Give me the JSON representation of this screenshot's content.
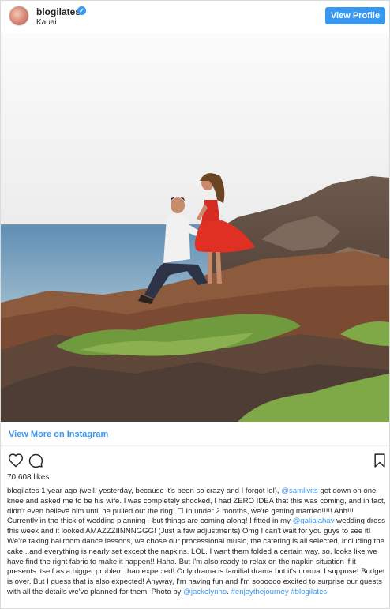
{
  "header": {
    "username": "blogilates",
    "location": "Kauai",
    "view_profile_label": "View Profile"
  },
  "photo": {
    "alt": "proposal photo"
  },
  "footer": {
    "view_more_label": "View More on Instagram",
    "likes": "70,608 likes"
  },
  "caption": {
    "username": "blogilates",
    "part1": " 1 year ago (well, yesterday, because it's been so crazy and I forgot lol), ",
    "mention1": "@samlivits",
    "part2": " got down on one knee and asked me to be his wife. I was completely shocked, I had ZERO IDEA that this was coming, and in fact, didn't even believe him until he pulled out the ring. ☐ In under 2 months, we're getting married!!!!! Ahh!!! Currently in the thick of wedding planning - but things are coming along! I fitted in my ",
    "mention2": "@galialahav",
    "part3": " wedding dress this week and it looked AMAZZZIINNNGGG! (Just a few adjustments) Omg I can't wait for you guys to see it! We're taking ballroom dance lessons, we chose our processional music, the catering is all selected, including the cake...and everything is nearly set except the napkins. LOL. I want them folded a certain way, so, looks like we have find the right fabric to make it happen!! Haha. But I'm also ready to relax on the napkin situation if it presents itself as a bigger problem than expected! Only drama is familial drama but it's normal I suppose! Budget is over. But I guess that is also expected! Anyway, I'm having fun and I'm soooooo excited to surprise our guests with all the details we've planned for them! Photo by ",
    "mention3": "@jackelynho",
    "part4": ". ",
    "hashtag1": "#enjoythejourney",
    "part5": " ",
    "hashtag2": "#blogilates"
  },
  "colors": {
    "accent": "#3897f0",
    "text": "#262626"
  },
  "icons": [
    "verified-icon",
    "heart-icon",
    "comment-icon",
    "bookmark-icon"
  ]
}
